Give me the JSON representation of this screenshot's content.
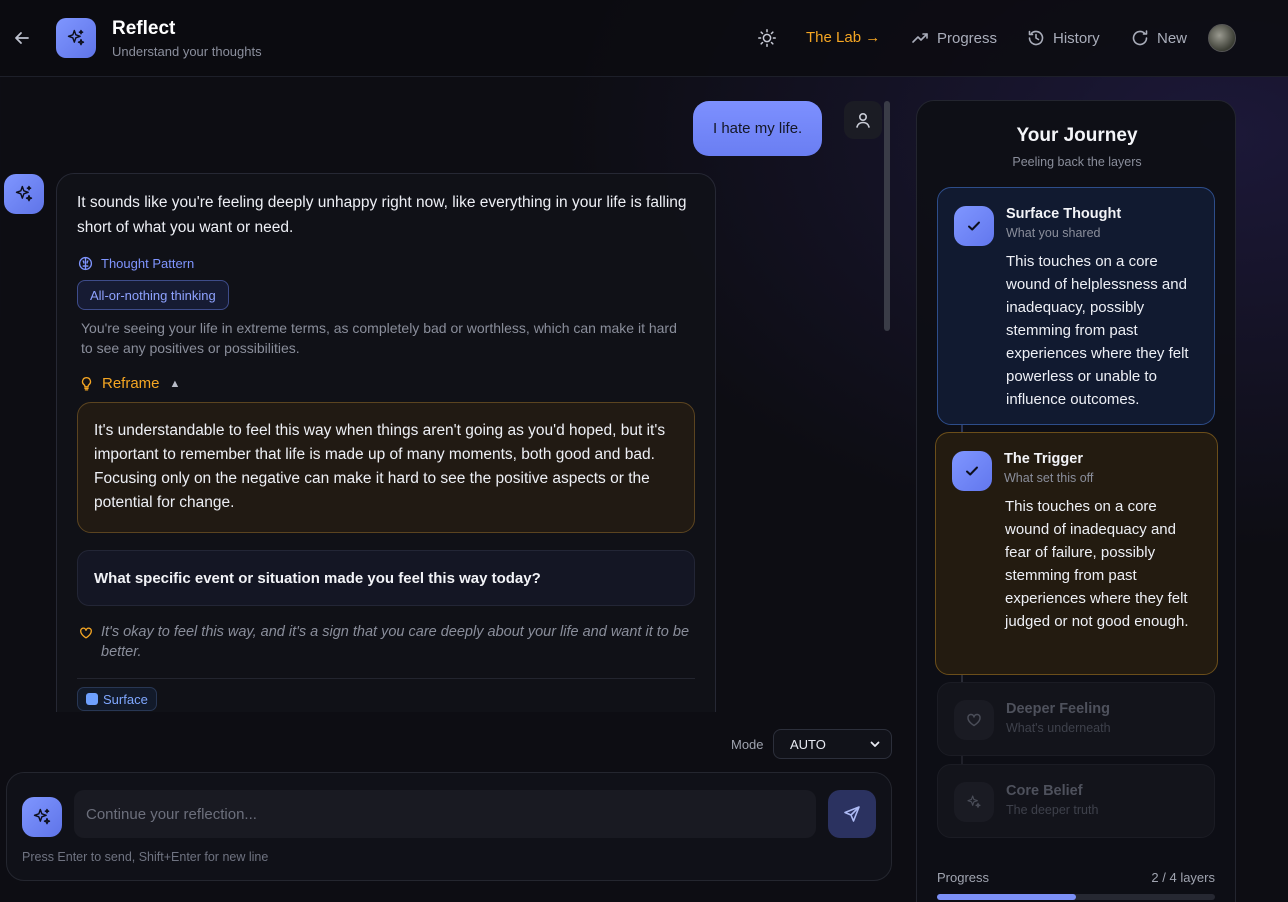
{
  "header": {
    "title": "Reflect",
    "subtitle": "Understand your thoughts",
    "nav": {
      "lab": "The Lab →",
      "progress": "Progress",
      "history": "History",
      "new": "New"
    }
  },
  "chat": {
    "user_message": "I hate my life.",
    "bot": {
      "message": "It sounds like you're feeling deeply unhappy right now, like everything in your life is falling short of what you want or need.",
      "thought_pattern_label": "Thought Pattern",
      "thought_pattern_chip": "All-or-nothing thinking",
      "thought_pattern_desc": "You're seeing your life in extreme terms, as completely bad or worthless, which can make it hard to see any positives or possibilities.",
      "reframe_label": "Reframe",
      "reframe_toggle": "▲",
      "reframe_text": "It's understandable to feel this way when things aren't going as you'd hoped, but it's important to remember that life is made up of many moments, both good and bad. Focusing only on the negative can make it hard to see the positive aspects or the potential for change.",
      "question": "What specific event or situation made you feel this way today?",
      "encouragement": "It's okay to feel this way, and it's a sign that you care deeply about your life and want it to be better.",
      "layer_chip": "Surface"
    }
  },
  "mode": {
    "label": "Mode",
    "selected": "AUTO"
  },
  "composer": {
    "placeholder": "Continue your reflection...",
    "hint": "Press Enter to send, Shift+Enter for new line"
  },
  "journey": {
    "title": "Your Journey",
    "subtitle": "Peeling back the layers",
    "steps": [
      {
        "name": "Surface Thought",
        "hint": "What you shared",
        "body": "This touches on a core wound of helplessness and inadequacy, possibly stemming from past experiences where they felt powerless or unable to influence outcomes."
      },
      {
        "name": "The Trigger",
        "hint": "What set this off",
        "body": "This touches on a core wound of inadequacy and fear of failure, possibly stemming from past experiences where they felt judged or not good enough."
      },
      {
        "name": "Deeper Feeling",
        "hint": "What's underneath"
      },
      {
        "name": "Core Belief",
        "hint": "The deeper truth"
      }
    ],
    "progress_label": "Progress",
    "progress_count": "2 / 4 layers",
    "progress_fraction": 0.5
  },
  "colors": {
    "accent": "#7b8ff6",
    "warm": "#f5a623"
  }
}
